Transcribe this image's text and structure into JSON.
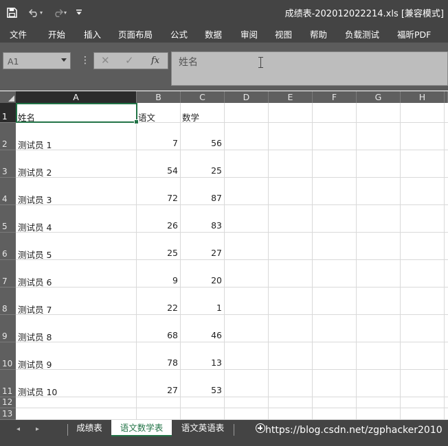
{
  "window": {
    "title": "成绩表-202012022214.xls  [兼容模式]"
  },
  "ribbon": {
    "tabs": [
      "文件",
      "开始",
      "插入",
      "页面布局",
      "公式",
      "数据",
      "审阅",
      "视图",
      "帮助",
      "负载测试",
      "福昕PDF"
    ]
  },
  "formula_bar": {
    "name_box": "A1",
    "content": "姓名"
  },
  "columns": [
    "A",
    "B",
    "C",
    "D",
    "E",
    "F",
    "G",
    "H"
  ],
  "rows": [
    {
      "num": "1",
      "a": "姓名",
      "b": "语文",
      "c": "数学"
    },
    {
      "num": "2",
      "a": "测试员 1",
      "b": "7",
      "c": "56"
    },
    {
      "num": "3",
      "a": "测试员 2",
      "b": "54",
      "c": "25"
    },
    {
      "num": "4",
      "a": "测试员 3",
      "b": "72",
      "c": "87"
    },
    {
      "num": "5",
      "a": "测试员 4",
      "b": "26",
      "c": "83"
    },
    {
      "num": "6",
      "a": "测试员 5",
      "b": "25",
      "c": "27"
    },
    {
      "num": "7",
      "a": "测试员 6",
      "b": "9",
      "c": "20"
    },
    {
      "num": "8",
      "a": "测试员 7",
      "b": "22",
      "c": "1"
    },
    {
      "num": "9",
      "a": "测试员 8",
      "b": "68",
      "c": "46"
    },
    {
      "num": "10",
      "a": "测试员 9",
      "b": "78",
      "c": "13"
    },
    {
      "num": "11",
      "a": "测试员 10",
      "b": "27",
      "c": "53"
    },
    {
      "num": "12",
      "a": "",
      "b": "",
      "c": ""
    },
    {
      "num": "13",
      "a": "",
      "b": "",
      "c": ""
    }
  ],
  "sheet_tabs": [
    "成绩表",
    "语文数学表",
    "语文英语表"
  ],
  "active_sheet": "语文数学表",
  "watermark": "https://blog.csdn.net/zgphacker2010",
  "colors": {
    "accent": "#217346",
    "titlebar": "#444444",
    "header": "#5f5f5f"
  }
}
